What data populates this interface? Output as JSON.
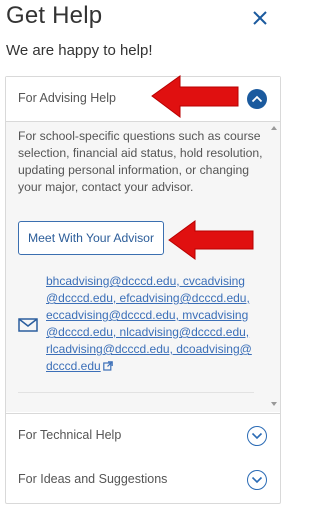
{
  "header": {
    "title": "Get Help",
    "subtitle": "We are happy to help!",
    "close_icon": "close-icon"
  },
  "accordion": {
    "items": [
      {
        "label": "For Advising Help",
        "expanded": true
      },
      {
        "label": "For Technical Help",
        "expanded": false
      },
      {
        "label": "For Ideas and Suggestions",
        "expanded": false
      }
    ],
    "advising": {
      "description": "For school-specific questions such as course selection, financial aid status, hold resolution, updating personal information, or changing your major, contact your advisor.",
      "button_label": "Meet With Your Advisor",
      "emails": "bhcadvising@dcccd.edu, cvcadvising@dcccd.edu, efcadvising@dcccd.edu, eccadvising@dcccd.edu, mvcadvising@dcccd.edu, nlcadvising@dcccd.edu, rlcadvising@dcccd.edu, dcoadvising@dcccd.edu"
    }
  },
  "colors": {
    "accent": "#1b5a9e",
    "link": "#3b6fb8",
    "annotation_arrow": "#e01010"
  }
}
